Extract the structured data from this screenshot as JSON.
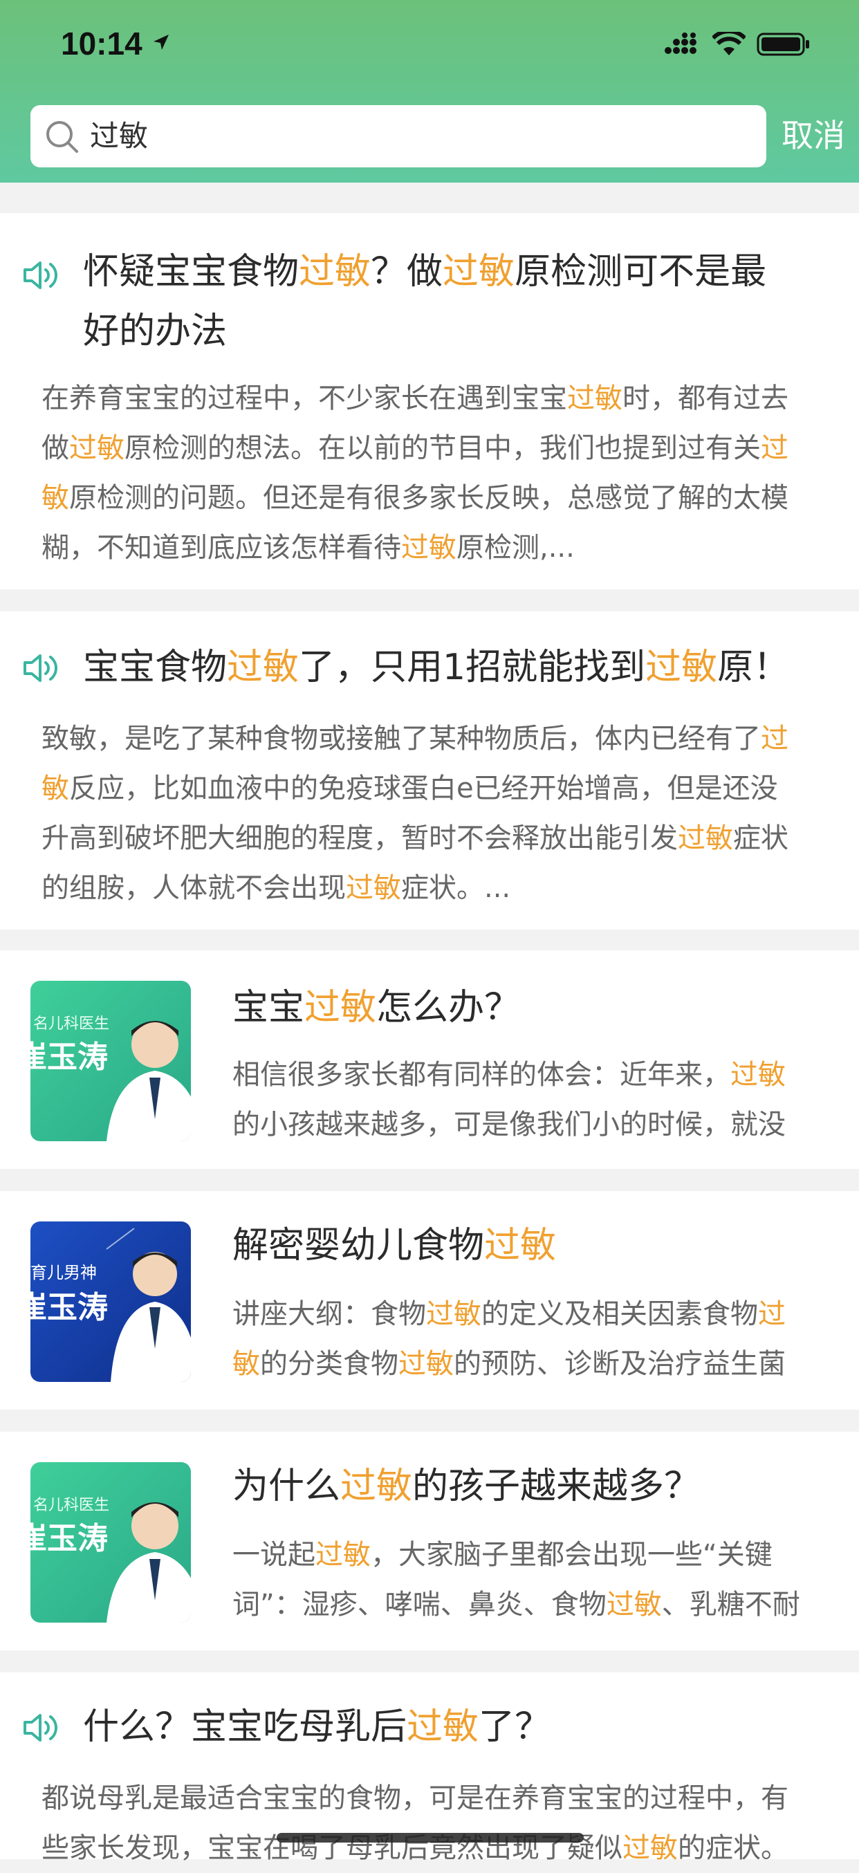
{
  "status_bar": {
    "time": "10:14"
  },
  "search": {
    "query": "过敏",
    "cancel_label": "取消"
  },
  "results": [
    {
      "title_parts": [
        "怀疑宝宝食物",
        "过敏",
        "？做",
        "过敏",
        "原检测可不是最"
      ],
      "title_line2": "好的办法",
      "desc_lines": [
        [
          "在养育宝宝的过程中，不少家长在遇到宝宝",
          "过敏",
          "时，都有过去"
        ],
        [
          "做",
          "过敏",
          "原检测的想法。在以前的节目中，我们也提到过有关",
          "过"
        ],
        [
          "敏",
          "原检测的问题。但还是有很多家长反映，总感觉了解的太模"
        ],
        [
          "糊，不知道到底应该怎样看待",
          "过敏",
          "原检测,..."
        ]
      ]
    },
    {
      "title_parts": [
        "宝宝食物",
        "过敏",
        "了，只用1招就能找到",
        "过敏",
        "原！"
      ],
      "desc_lines": [
        [
          "致敏，是吃了某种食物或接触了某种物质后，体内已经有了",
          "过"
        ],
        [
          "敏",
          "反应，比如血液中的免疫球蛋白e已经开始增高，但是还没"
        ],
        [
          "升高到破坏肥大细胞的程度，暂时不会释放出能引发",
          "过敏",
          "症状"
        ],
        [
          "的组胺，人体就不会出现",
          "过敏",
          "症状。..."
        ]
      ]
    },
    {
      "thumb_text": [
        "名儿科医生",
        "崔玉涛"
      ],
      "title_parts": [
        "宝宝",
        "过敏",
        "怎么办？"
      ],
      "desc_lines": [
        [
          "相信很多家长都有同样的体会：近年来，",
          "过敏"
        ],
        [
          "的小孩越来越多，可是像我们小的时候，就没"
        ]
      ]
    },
    {
      "thumb_text": [
        "育儿男神",
        "崔玉涛"
      ],
      "title_parts": [
        "解密婴幼儿食物",
        "过敏"
      ],
      "desc_lines": [
        [
          "讲座大纲：食物",
          "过敏",
          "的定义及相关因素食物",
          "过"
        ],
        [
          "敏",
          "的分类食物",
          "过敏",
          "的预防、诊断及治疗益生菌"
        ]
      ]
    },
    {
      "thumb_text": [
        "名儿科医生",
        "崔玉涛"
      ],
      "title_parts": [
        "为什么",
        "过敏",
        "的孩子越来越多？"
      ],
      "desc_lines": [
        [
          "一说起",
          "过敏",
          "，大家脑子里都会出现一些“关键"
        ],
        [
          "词”：湿疹、哮喘、鼻炎、食物",
          "过敏",
          "、乳糖不耐"
        ]
      ]
    },
    {
      "title_parts": [
        "什么？宝宝吃母乳后",
        "过敏",
        "了？"
      ],
      "desc_lines": [
        [
          "都说母乳是最适合宝宝的食物，可是在养育宝宝的过程中，有"
        ],
        [
          "些家长发现，宝宝在喝了母乳后竟然出现了疑似",
          "过敏",
          "的症状。"
        ]
      ]
    }
  ],
  "colors": {
    "highlight": "#f0a030",
    "header_start": "#6cc17a",
    "header_end": "#5fc9a0"
  }
}
